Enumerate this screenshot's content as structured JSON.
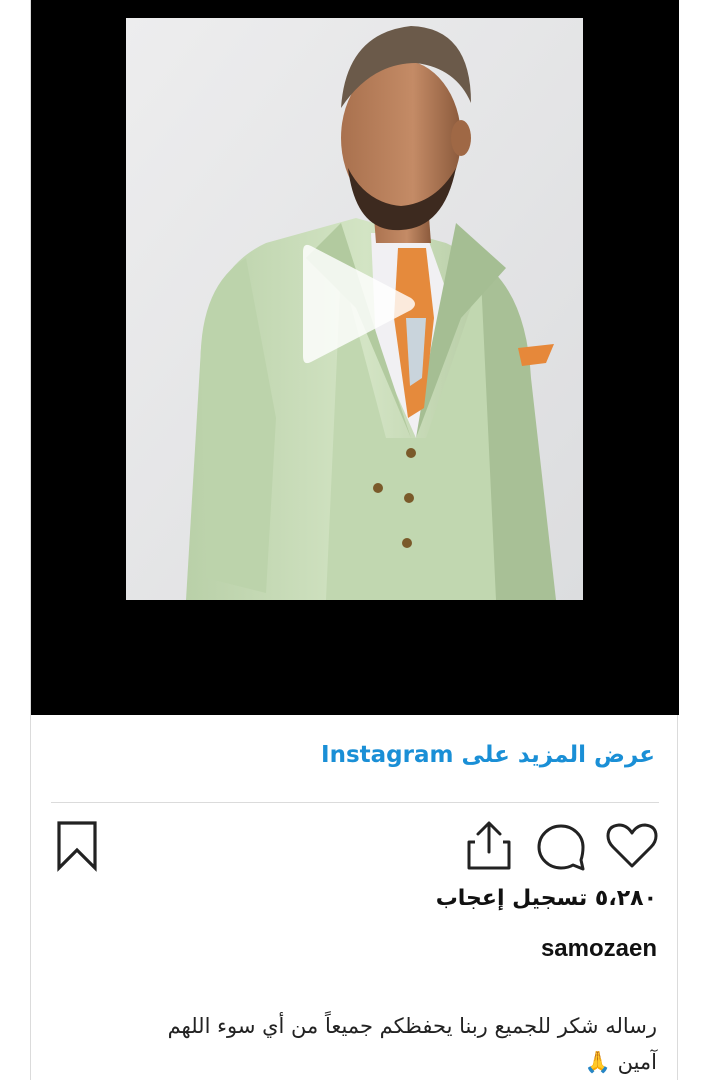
{
  "embed": {
    "view_more_label": "عرض المزيد على Instagram",
    "likes_text": "٥،٢٨٠ تسجيل إعجاب",
    "username": "samozaen",
    "caption_line1": "رساله شكر للجميع ربنا يحفظكم جميعاً من أي سوء اللهم",
    "caption_line2": "آمين 🙏"
  },
  "icons": {
    "play": "play-icon",
    "bookmark": "bookmark-icon",
    "share": "share-icon",
    "comment": "comment-icon",
    "like": "heart-icon"
  },
  "colors": {
    "link": "#1a8fd6",
    "media_bg": "#000000",
    "suit": "#c8dcb8"
  }
}
